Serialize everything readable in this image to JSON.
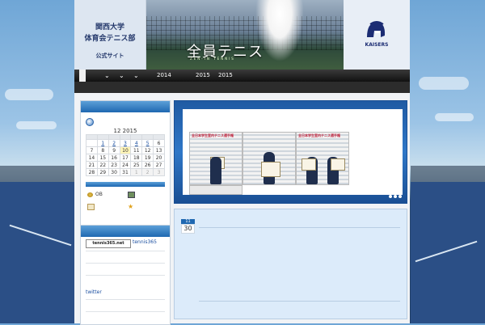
{
  "site": {
    "title_lines": [
      "関西大学",
      "体育会テニス部"
    ],
    "subtitle": "公式サイト",
    "slogan": "全員テニス",
    "slogan_sub": "ZEN-IN TENNIS",
    "logo_text": "KAISERS"
  },
  "nav": {
    "links": [
      "2014",
      "2015",
      "2015"
    ]
  },
  "calendar": {
    "caption": "12 2015",
    "weeks": [
      [
        "",
        "1",
        "2",
        "3",
        "4",
        "5",
        "6"
      ],
      [
        "7",
        "8",
        "9",
        "10",
        "11",
        "12",
        "13"
      ],
      [
        "14",
        "15",
        "16",
        "17",
        "18",
        "19",
        "20"
      ],
      [
        "21",
        "22",
        "23",
        "24",
        "25",
        "26",
        "27"
      ],
      [
        "28",
        "29",
        "30",
        "31",
        "1",
        "2",
        "3"
      ]
    ]
  },
  "sidebar": {
    "items": [
      {
        "icon": "ball-icon",
        "label": "OB"
      },
      {
        "icon": "image-icon",
        "label": ""
      },
      {
        "icon": "calendar-icon",
        "label": ""
      },
      {
        "icon": "star-icon",
        "label": ""
      }
    ],
    "tennis365_logo": "tennis365.net",
    "tennis365_link": "tennis365",
    "twitter": "twitter"
  },
  "slider": {
    "photo_titles": [
      "全日本学生室内テニス選手権",
      "",
      "全日本学生室内テニス選手権"
    ]
  },
  "post": {
    "month": "11",
    "day": "30"
  },
  "colors": {
    "accent": "#1f68b1",
    "nav": "#111111",
    "post_bg": "#dcebfa"
  }
}
